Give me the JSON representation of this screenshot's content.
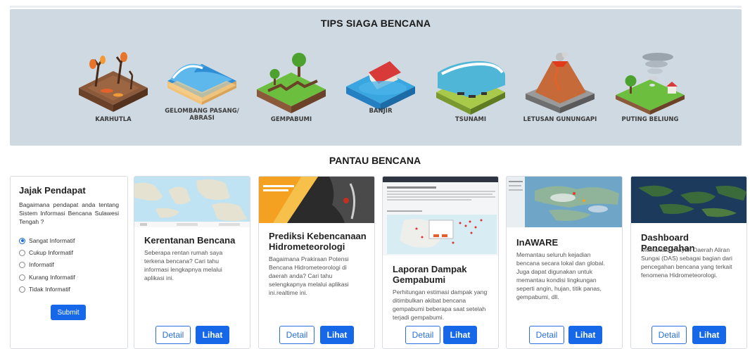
{
  "tips": {
    "title": "TIPS SIAGA BENCANA",
    "items": [
      {
        "label": "KARHUTLA",
        "icon": "wildfire-icon"
      },
      {
        "label": "GELOMBANG PASANG/ ABRASI",
        "icon": "tidal-wave-icon"
      },
      {
        "label": "GEMPABUMI",
        "icon": "earthquake-icon"
      },
      {
        "label": "BANJIR",
        "icon": "flood-icon"
      },
      {
        "label": "TSUNAMI",
        "icon": "tsunami-icon"
      },
      {
        "label": "LETUSAN GUNUNGAPI",
        "icon": "volcano-icon"
      },
      {
        "label": "PUTING BELIUNG",
        "icon": "tornado-icon"
      }
    ]
  },
  "pantau": {
    "title": "PANTAU BENCANA"
  },
  "poll": {
    "title": "Jajak Pendapat",
    "description": "Bagaimana pendapat anda tentang Sistem Informasi Bencana Sulawesi Tengah ?",
    "options": [
      "Sangat Informatif",
      "Cukup Informatif",
      "Informatif",
      "Kurang Informatif",
      "Tidak Informatif"
    ],
    "selected": "Sangat Informatif",
    "submit_label": "Submit"
  },
  "cards": [
    {
      "title": "Kerentanan Bencana",
      "text": "Seberapa rentan rumah saya terkena bencana? Cari tahu informasi lengkapnya melalui aplikasi ini.",
      "detail_label": "Detail",
      "lihat_label": "Lihat"
    },
    {
      "title": "Prediksi Kebencanaan Hidrometeorologi",
      "text": "Bagaimana Prakiraan Potensi Bencana Hidrometeorologi di daerah anda? Cari tahu selengkapnya melalui aplikasi ini.realtime ini.",
      "detail_label": "Detail",
      "lihat_label": "Lihat"
    },
    {
      "title": "Laporan Dampak Gempabumi",
      "text": "Perhitungan estimasi dampak yang ditimbulkan akibat bencana gempabumi beberapa saat setelah terjadi gempabumi.",
      "detail_label": "Detail",
      "lihat_label": "Lihat"
    },
    {
      "title": "InAWARE",
      "text": "Memantau seluruh kejadian bencana secara lokal dan global. Juga dapat digunakan untuk memantau kondisi lingkungan seperti angin, hujan, titik panas, gempabumi, dll.",
      "detail_label": "Detail",
      "lihat_label": "Lihat"
    },
    {
      "title": "Dashboard Pencegahan",
      "text": "Memantau wilayah Daerah Aliran Sungai (DAS) sebagai bagian dari pencegahan bencana yang terkait fenomena Hidrometeorologi.",
      "detail_label": "Detail",
      "lihat_label": "Lihat"
    }
  ],
  "colors": {
    "primary": "#1668e8",
    "tips_bg": "#cfd9e2",
    "card_border": "#d9dde2"
  }
}
